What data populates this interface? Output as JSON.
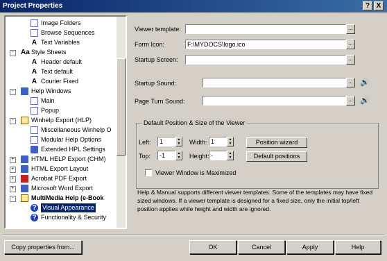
{
  "window": {
    "title": "Project Properties",
    "help_glyph": "?",
    "close_glyph": "X"
  },
  "tree": {
    "items": [
      {
        "label": "Image Folders",
        "icon": "page-icon",
        "glyph": ""
      },
      {
        "label": "Browse Sequences",
        "icon": "page-icon",
        "glyph": ""
      },
      {
        "label": "Text Variables",
        "icon": "text-a-icon",
        "glyph": "A"
      },
      {
        "label": "Style Sheets",
        "icon": "styles-icon",
        "glyph": "Aa",
        "expander": "-"
      },
      {
        "label": "Header default",
        "icon": "text-a-icon",
        "glyph": "A"
      },
      {
        "label": "Text default",
        "icon": "text-a-icon",
        "glyph": "A"
      },
      {
        "label": "Courier Fixed",
        "icon": "text-a-icon",
        "glyph": "A"
      },
      {
        "label": "Help Windows",
        "icon": "window-icon",
        "glyph": "",
        "expander": "-"
      },
      {
        "label": "Main",
        "icon": "page-icon",
        "glyph": ""
      },
      {
        "label": "Popup",
        "icon": "page-icon",
        "glyph": ""
      },
      {
        "label": "Winhelp Export (HLP)",
        "icon": "winhelp-icon",
        "glyph": "",
        "expander": "-"
      },
      {
        "label": "Miscellaneous Winhelp O",
        "icon": "page-icon",
        "glyph": ""
      },
      {
        "label": "Modular Help Options",
        "icon": "page-icon",
        "glyph": ""
      },
      {
        "label": "Extended HPL Settings",
        "icon": "settings-icon",
        "glyph": ""
      },
      {
        "label": "HTML HELP Export (CHM)",
        "icon": "chm-icon",
        "glyph": "",
        "expander": "+"
      },
      {
        "label": "HTML Export Layout",
        "icon": "html-icon",
        "glyph": "",
        "expander": "+"
      },
      {
        "label": "Acrobat PDF Export",
        "icon": "pdf-icon",
        "glyph": "",
        "expander": "+"
      },
      {
        "label": "Microsoft Word Export",
        "icon": "word-icon",
        "glyph": "",
        "expander": "+"
      },
      {
        "label": "MultiMedia Help (e-Book",
        "icon": "ebook-icon",
        "glyph": "",
        "expander": "-"
      },
      {
        "label": "Visual Appearance",
        "icon": "help-icon",
        "glyph": "?"
      },
      {
        "label": "Functionality & Security",
        "icon": "help-icon",
        "glyph": "?"
      }
    ]
  },
  "form": {
    "viewer_template_label": "Viewer template:",
    "viewer_template_value": "",
    "form_icon_label": "Form Icon:",
    "form_icon_value": "F:\\MYDOCS\\logo.ico",
    "startup_screen_label": "Startup Screen:",
    "startup_screen_value": "",
    "startup_sound_label": "Startup Sound:",
    "startup_sound_value": "",
    "page_turn_sound_label": "Page Turn Sound:",
    "page_turn_sound_value": "",
    "browse_glyph": "..."
  },
  "position": {
    "group_title": "Default Position & Size of the Viewer",
    "left_label": "Left:",
    "left_value": "1",
    "width_label": "Width:",
    "width_value": "1",
    "top_label": "Top:",
    "top_value": "-1",
    "height_label": "Height:",
    "height_value": "-",
    "position_wizard": "Position wizard",
    "default_positions": "Default positions",
    "maximized_label": "Viewer Window is Maximized",
    "maximized_checked": false
  },
  "description": "Help & Manual supports different viewer templates. Some of the templates may have fixed sized windows. If a viewer template is designed for a fixed size, only the initial top/left position applies while height and width are ignored.",
  "buttons": {
    "copy_properties": "Copy properties from...",
    "ok": "OK",
    "cancel": "Cancel",
    "apply": "Apply",
    "help": "Help"
  },
  "colors": {
    "titlebar_start": "#0a246a",
    "titlebar_end": "#3a6ea5",
    "dialog_bg": "#d4d0c8",
    "selection": "#0a246a"
  }
}
